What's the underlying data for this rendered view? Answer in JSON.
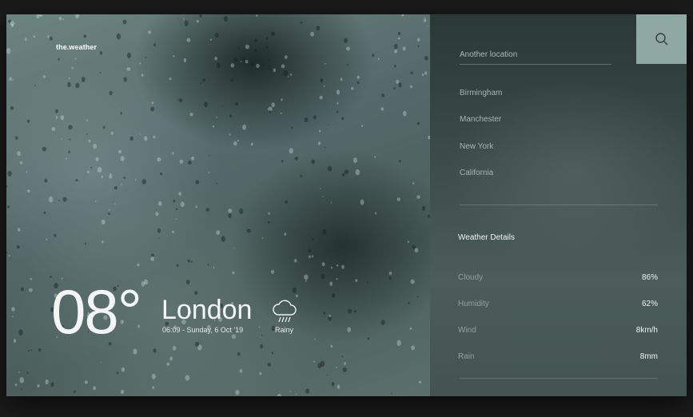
{
  "brand": "the.weather",
  "current": {
    "temperature": "08°",
    "city": "London",
    "datetime": "06:09 - Sunday, 6 Oct '19",
    "condition": "Rainy",
    "condition_icon": "rain-cloud-icon"
  },
  "search": {
    "placeholder": "Another location",
    "icon": "search-icon"
  },
  "locations": [
    "Birmingham",
    "Manchester",
    "New York",
    "California"
  ],
  "details": {
    "title": "Weather Details",
    "rows": [
      {
        "label": "Cloudy",
        "value": "86%"
      },
      {
        "label": "Humidity",
        "value": "62%"
      },
      {
        "label": "Wind",
        "value": "8km/h"
      },
      {
        "label": "Rain",
        "value": "8mm"
      }
    ]
  },
  "colors": {
    "accent": "#8fa8a3",
    "text": "#f4f6f5"
  }
}
